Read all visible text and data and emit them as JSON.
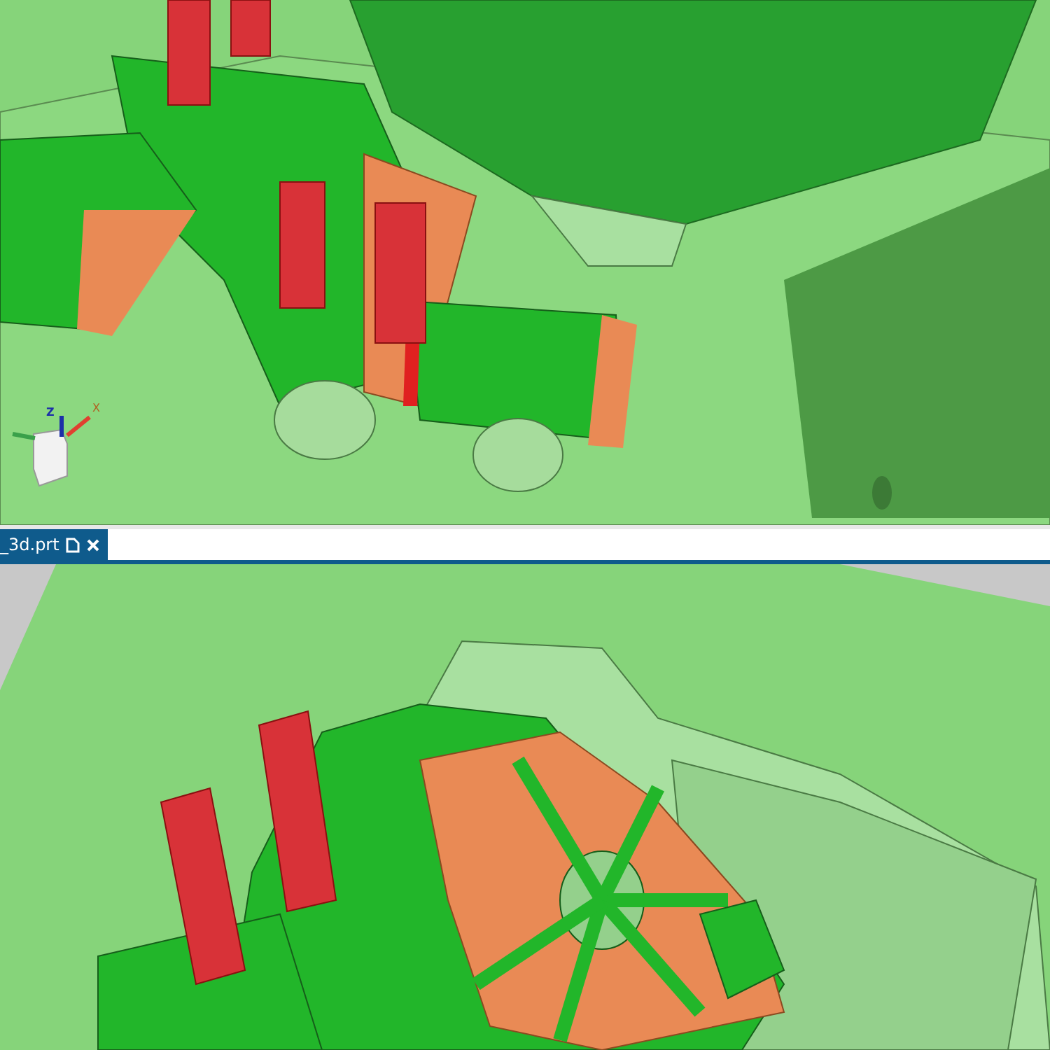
{
  "top_viewport": {
    "triad": {
      "z_label": "Z",
      "x_label": "X"
    }
  },
  "tabs": [
    {
      "label": "_3d.prt",
      "selected": true
    }
  ]
}
